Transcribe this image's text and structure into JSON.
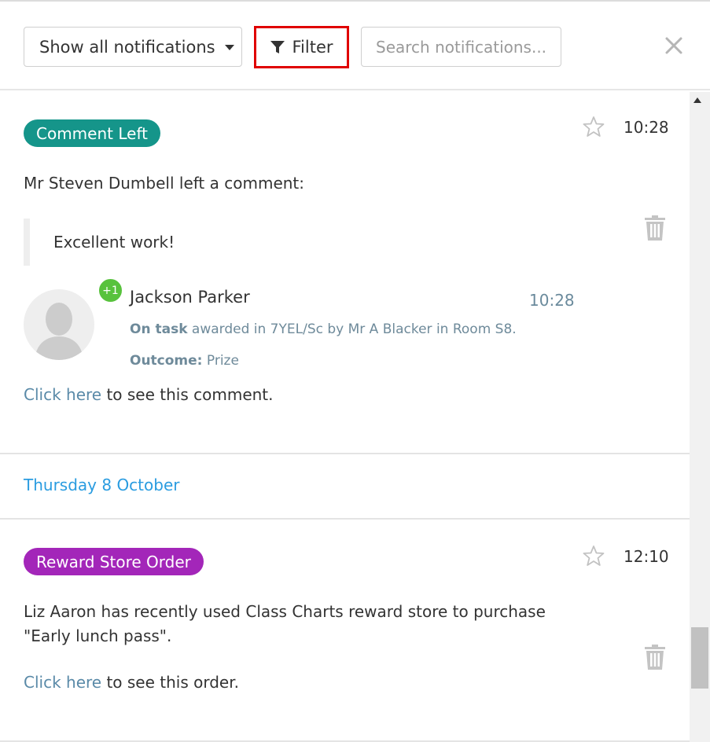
{
  "toolbar": {
    "dropdown_label": "Show all notifications",
    "filter_label": "Filter",
    "search_placeholder": "Search notifications..."
  },
  "notifications": [
    {
      "badge": "Comment Left",
      "badge_color": "#15958a",
      "time": "10:28",
      "message": "Mr Steven Dumbell left a comment:",
      "quote": "Excellent work!",
      "award": {
        "points": "+1",
        "student": "Jackson Parker",
        "time": "10:28",
        "behaviour": "On task",
        "detail": " awarded in 7YEL/Sc by Mr A Blacker in Room S8.",
        "outcome_label": "Outcome:",
        "outcome": " Prize"
      },
      "link_text": "Click here",
      "link_suffix": " to see this comment."
    },
    {
      "badge": "Reward Store Order",
      "badge_color": "#a326b9",
      "time": "12:10",
      "message_line1": "Liz Aaron has recently used Class Charts reward store to purchase",
      "message_line2": "\"Early lunch pass\".",
      "link_text": "Click here",
      "link_suffix": " to see this order."
    }
  ],
  "day_header": "Thursday 8 October",
  "colors": {
    "filter_highlight": "#e00000",
    "date_header": "#2a9ce0",
    "points_badge": "#58c23d"
  }
}
